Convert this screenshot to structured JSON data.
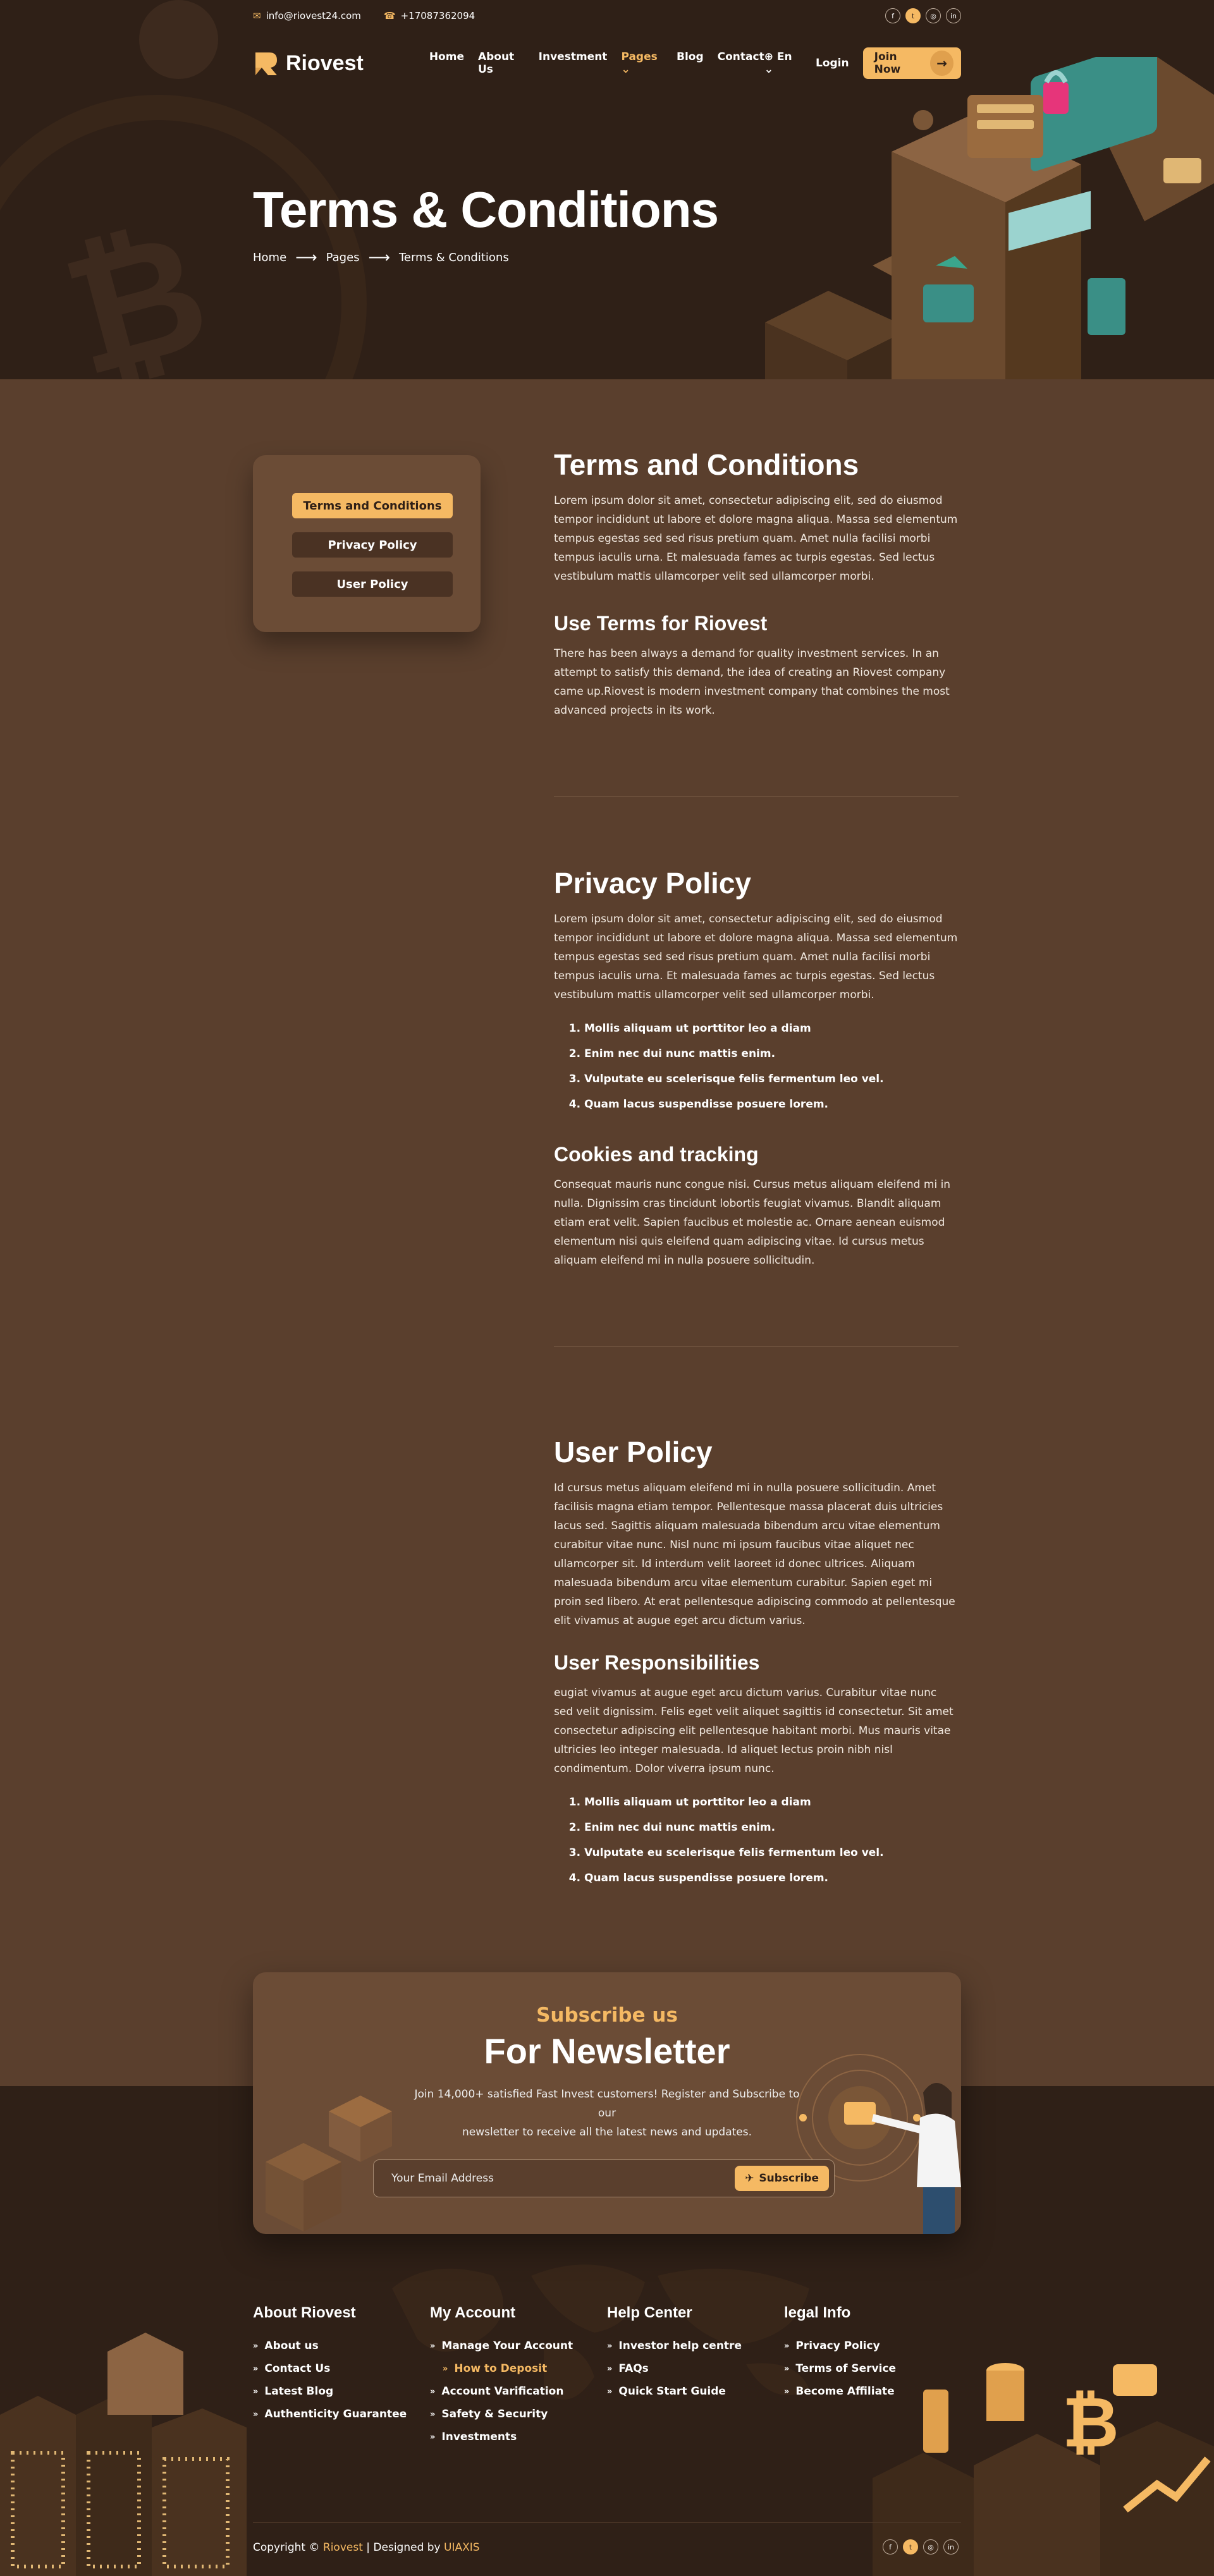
{
  "topbar": {
    "email": "info@riovest24.com",
    "phone": "+17087362094",
    "social": [
      "facebook-icon",
      "twitter-icon",
      "instagram-icon",
      "linkedin-icon"
    ]
  },
  "nav": {
    "logo": "Riovest",
    "items": [
      "Home",
      "About Us",
      "Investment",
      "Pages",
      "Blog",
      "Contact"
    ],
    "active": "Pages",
    "language": "En",
    "login": "Login",
    "join": "Join Now"
  },
  "hero": {
    "title": "Terms & Conditions",
    "breadcrumb": [
      "Home",
      "Pages",
      "Terms & Conditions"
    ]
  },
  "sidebar": {
    "items": [
      "Terms and Conditions",
      "Privacy Policy",
      "User Policy"
    ]
  },
  "sections": {
    "terms": {
      "title": "Terms and Conditions",
      "body": "Lorem ipsum dolor sit amet, consectetur adipiscing elit, sed do eiusmod tempor incididunt ut labore et dolore magna aliqua. Massa sed elementum tempus egestas sed sed risus pretium quam. Amet nulla facilisi morbi tempus iaculis urna. Et malesuada fames ac turpis egestas. Sed lectus vestibulum mattis ullamcorper velit sed ullamcorper morbi."
    },
    "use_terms": {
      "title": "Use Terms for Riovest",
      "body": "There has been always a demand for quality investment services. In an attempt to satisfy this demand, the idea of creating an Riovest  company came up.Riovest is modern investment company that combines the most advanced projects in its work."
    },
    "privacy": {
      "title": "Privacy Policy",
      "body": "Lorem ipsum dolor sit amet, consectetur adipiscing elit, sed do eiusmod tempor incididunt ut labore et dolore magna aliqua. Massa sed elementum tempus egestas sed sed risus pretium quam. Amet nulla facilisi morbi tempus iaculis urna. Et malesuada fames ac turpis egestas. Sed lectus vestibulum mattis ullamcorper velit sed ullamcorper morbi.",
      "list": [
        "Mollis aliquam ut porttitor leo a diam",
        "Enim nec dui nunc mattis enim.",
        "Vulputate eu scelerisque felis fermentum leo vel.",
        "Quam lacus suspendisse posuere lorem."
      ]
    },
    "cookies": {
      "title": "Cookies and tracking",
      "body": "Consequat mauris nunc congue nisi. Cursus metus aliquam eleifend mi in nulla. Dignissim cras tincidunt lobortis feugiat vivamus. Blandit aliquam etiam erat velit. Sapien faucibus et molestie ac. Ornare aenean euismod elementum nisi quis eleifend quam adipiscing vitae. Id cursus metus aliquam eleifend mi in nulla posuere sollicitudin."
    },
    "user_policy": {
      "title": "User Policy",
      "body": "Id cursus metus aliquam eleifend mi in nulla posuere sollicitudin. Amet facilisis magna etiam tempor. Pellentesque massa placerat duis ultricies lacus sed. Sagittis aliquam malesuada bibendum arcu vitae elementum curabitur vitae nunc. Nisl nunc mi ipsum faucibus vitae aliquet nec ullamcorper sit. Id interdum velit laoreet id donec ultrices. Aliquam malesuada bibendum arcu vitae elementum curabitur. Sapien eget mi proin sed libero. At erat pellentesque adipiscing commodo at pellentesque elit vivamus at augue eget arcu dictum varius."
    },
    "responsibilities": {
      "title": "User Responsibilities",
      "body": "eugiat vivamus at augue eget arcu dictum varius. Curabitur vitae nunc sed velit dignissim. Felis eget velit aliquet sagittis id consectetur. Sit amet consectetur adipiscing elit pellentesque habitant morbi. Mus mauris vitae ultricies leo integer malesuada. Id aliquet lectus proin nibh nisl condimentum. Dolor viverra ipsum nunc.",
      "list": [
        "Mollis aliquam ut porttitor leo a diam",
        "Enim nec dui nunc mattis enim.",
        "Vulputate eu scelerisque felis fermentum leo vel.",
        "Quam lacus suspendisse posuere lorem."
      ]
    }
  },
  "newsletter": {
    "subtitle": "Subscribe us",
    "title": "For Newsletter",
    "desc_line1": "Join 14,000+ satisfied Fast Invest customers! Register and Subscribe to our",
    "desc_line2": "newsletter to receive all the latest news and updates.",
    "placeholder": "Your Email Address",
    "button": "Subscribe"
  },
  "footer": {
    "about": {
      "title": "About Riovest",
      "items": [
        "About us",
        "Contact Us",
        "Latest Blog",
        "Authenticity Guarantee"
      ]
    },
    "account": {
      "title": "My Account",
      "items": [
        "Manage Your Account",
        "How to Deposit",
        "Account Varification",
        "Safety & Security",
        "Investments"
      ]
    },
    "help": {
      "title": "Help Center",
      "items": [
        "Investor help centre",
        "FAQs",
        "Quick Start Guide"
      ]
    },
    "legal": {
      "title": "legal Info",
      "items": [
        "Privacy Policy",
        "Terms of Service",
        "Become Affiliate"
      ]
    },
    "copyright_prefix": "Copyright ©",
    "brand": "Riovest",
    "designed_by": "| Designed by",
    "designer": "UIAXIS"
  },
  "colors": {
    "accent": "#f5b963",
    "dark": "#2f2017",
    "main": "#5a3f2d",
    "card": "#6b4c36"
  }
}
